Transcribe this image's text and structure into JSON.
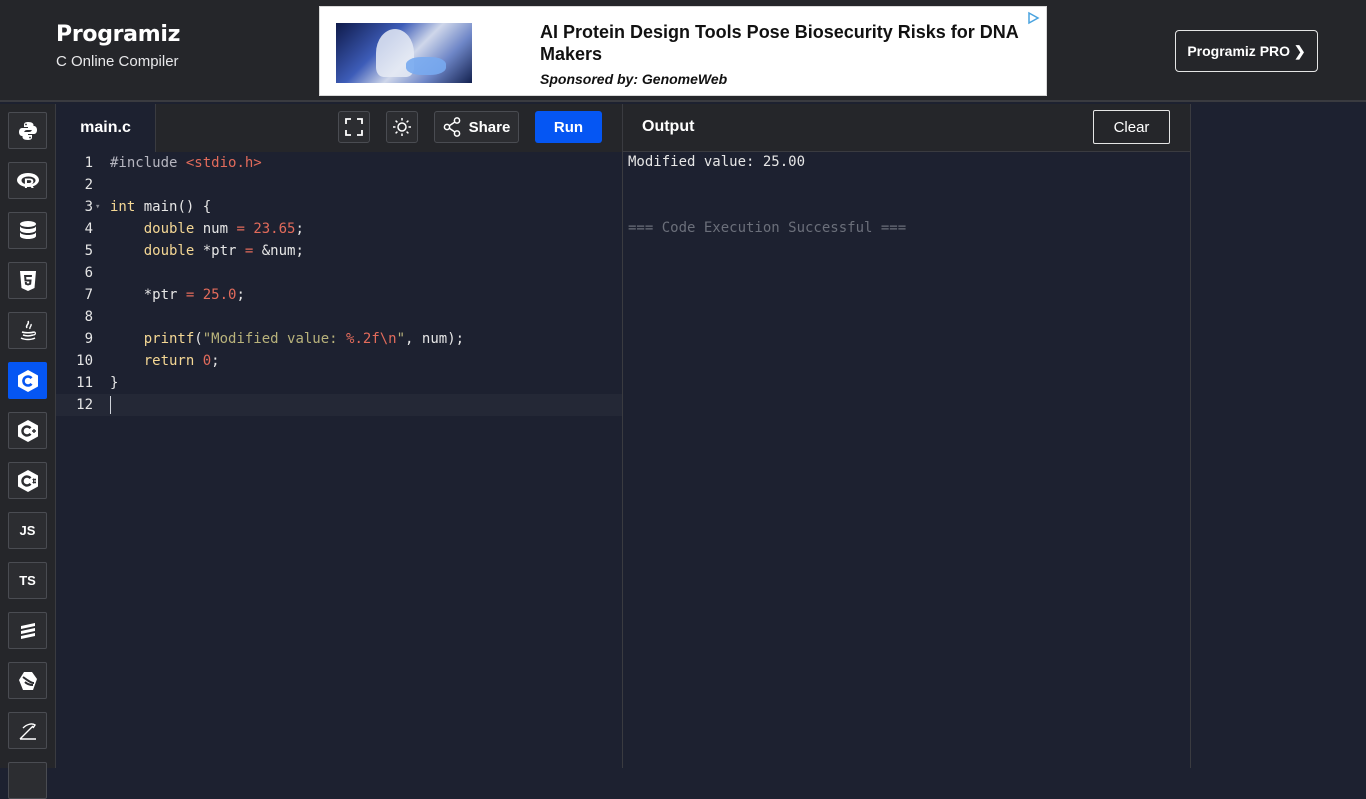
{
  "header": {
    "logo_text": "Programiz",
    "subtitle": "C Online Compiler",
    "pro_button": "Programiz PRO ❯"
  },
  "ad": {
    "title": "AI Protein Design Tools Pose Biosecurity Risks for DNA Makers",
    "sponsor": "Sponsored by: GenomeWeb"
  },
  "sidebar": {
    "items": [
      {
        "name": "python",
        "label": ""
      },
      {
        "name": "r",
        "label": ""
      },
      {
        "name": "sql",
        "label": ""
      },
      {
        "name": "html",
        "label": ""
      },
      {
        "name": "java",
        "label": ""
      },
      {
        "name": "c",
        "label": "",
        "active": true
      },
      {
        "name": "cpp",
        "label": ""
      },
      {
        "name": "csharp",
        "label": ""
      },
      {
        "name": "javascript",
        "label": "JS"
      },
      {
        "name": "typescript",
        "label": "TS"
      },
      {
        "name": "go",
        "label": ""
      },
      {
        "name": "swift",
        "label": ""
      },
      {
        "name": "rust",
        "label": ""
      }
    ]
  },
  "editor": {
    "tab": "main.c",
    "share_label": "Share",
    "run_label": "Run",
    "lines": [
      {
        "n": "1"
      },
      {
        "n": "2"
      },
      {
        "n": "3"
      },
      {
        "n": "4"
      },
      {
        "n": "5"
      },
      {
        "n": "6"
      },
      {
        "n": "7"
      },
      {
        "n": "8"
      },
      {
        "n": "9"
      },
      {
        "n": "10"
      },
      {
        "n": "11"
      },
      {
        "n": "12"
      }
    ],
    "code": {
      "l1_pp": "#include",
      "l1_inc": "<stdio.h>",
      "l3_kw": "int",
      "l3_rest": " main() {",
      "l4_kw": "double",
      "l4_mid": " num ",
      "l4_eq": "=",
      "l4_num": "23.65",
      "l4_end": ";",
      "l5_kw": "double",
      "l5_mid": " *ptr ",
      "l5_eq": "=",
      "l5_rest": " &num;",
      "l7_a": "*ptr ",
      "l7_eq": "=",
      "l7_num": "25.0",
      "l7_end": ";",
      "l9_fn": "printf",
      "l9_open": "(",
      "l9_str": "\"Modified value: ",
      "l9_fmt": "%.2f\\n",
      "l9_strend": "\"",
      "l9_rest": ", num);",
      "l10_kw": "return",
      "l10_num": "0",
      "l10_end": ";",
      "l11": "}"
    }
  },
  "output": {
    "label": "Output",
    "clear_label": "Clear",
    "line1": "Modified value: 25.00",
    "line2": "=== Code Execution Successful ==="
  }
}
